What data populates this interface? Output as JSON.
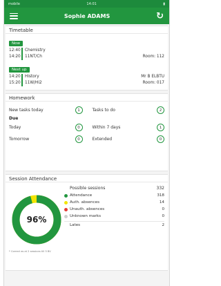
{
  "status_bar": {
    "left": "mobile",
    "time": "14:01"
  },
  "header": {
    "title": "Sophie ADAMS"
  },
  "timetable": {
    "title": "Timetable",
    "now_tag": "Now",
    "now": {
      "start": "12:40",
      "end": "14:20",
      "subject": "Chemistry",
      "class": "11NT/Ch",
      "room": "Room: 112"
    },
    "next_tag": "Next up",
    "next": {
      "start": "14:20",
      "end": "15:20",
      "subject": "History",
      "class": "11W/Hi2",
      "teacher": "Mr B ELBTU",
      "room": "Room: 017"
    }
  },
  "homework": {
    "title": "Homework",
    "new_tasks_label": "New tasks today",
    "new_tasks_count": "1",
    "todo_label": "Tasks to do",
    "todo_count": "2",
    "due_label": "Due",
    "today_label": "Today",
    "today_count": "0",
    "within7_label": "Within 7 days",
    "within7_count": "1",
    "tomorrow_label": "Tomorrow",
    "tomorrow_count": "0",
    "extended_label": "Extended",
    "extended_count": "0"
  },
  "attendance": {
    "title": "Session Attendance",
    "percent": "96%",
    "possible_label": "Possible sessions",
    "possible_value": "332",
    "items": [
      {
        "label": "Attendance",
        "value": "318",
        "color": "#22963f"
      },
      {
        "label": "Auth. absences",
        "value": "14",
        "color": "#f2e400"
      },
      {
        "label": "Unauth. absences",
        "value": "0",
        "color": "#e53935"
      },
      {
        "label": "Unknown marks",
        "value": "0",
        "color": "#cfcfcf"
      }
    ],
    "lates_label": "Lates",
    "lates_value": "2",
    "attendance_fraction": 0.958,
    "footnote": "* Correct as at 2 sessions till 5 BV"
  }
}
